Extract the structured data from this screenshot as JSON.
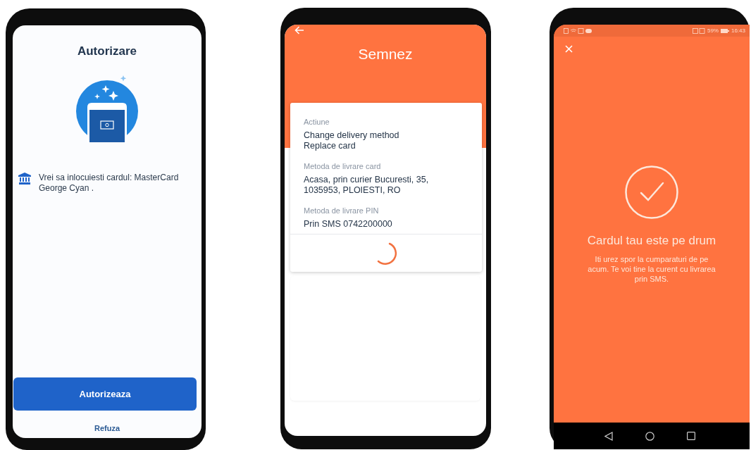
{
  "authorization_screen": {
    "title": "Autorizare",
    "message": "Vrei sa inlocuiesti cardul: MasterCard George Cyan .",
    "primary_button": "Autorizeaza",
    "secondary_button": "Refuza"
  },
  "signing_screen": {
    "title": "Semnez",
    "fields": [
      {
        "label": "Actiune",
        "lines": [
          "Change delivery method",
          "Replace card"
        ]
      },
      {
        "label": "Metoda de livrare card",
        "lines": [
          "Acasa, prin curier Bucuresti, 35,",
          "1035953, PLOIESTI, RO"
        ]
      },
      {
        "label": "Metoda de livrare PIN",
        "lines": [
          "Prin SMS 0742200000"
        ]
      }
    ]
  },
  "success_screen": {
    "status_bar": {
      "battery": "59%",
      "time": "16:43"
    },
    "title": "Cardul tau este pe drum",
    "message": "Iti urez spor la cumparaturi de pe acum. Te voi tine la curent cu livrarea prin SMS."
  }
}
